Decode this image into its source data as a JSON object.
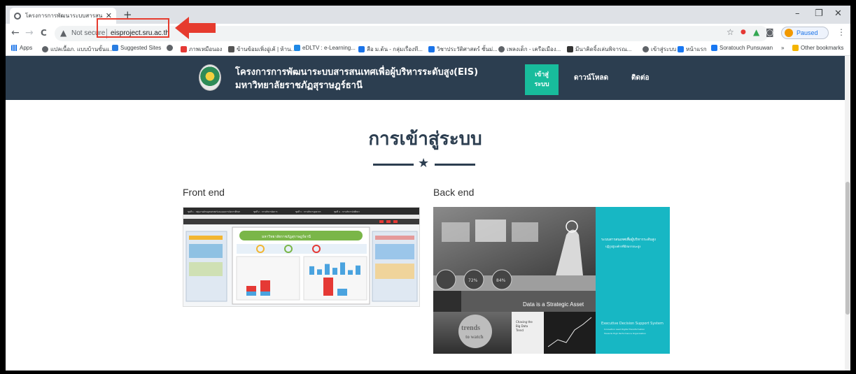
{
  "browser": {
    "tab_title": "โครงการการพัฒนาระบบสารสนเทศเพื่",
    "new_tab": "+",
    "window_controls": {
      "minimize": "–",
      "restore": "❐",
      "close": "✕"
    },
    "nav": {
      "back": "←",
      "forward": "→",
      "reload": "C"
    },
    "security_label": "Not secure",
    "url": "eisproject.sru.ac.th",
    "profile_status": "Paused",
    "bookmarks": [
      {
        "label": "Apps",
        "color": "#5f6368"
      },
      {
        "label": "แปลเนื้อภ. แบบบ้านขั้นแ...",
        "color": "#5f6368"
      },
      {
        "label": "Suggested Sites",
        "color": "#2a7de1"
      },
      {
        "label": "",
        "color": "#5f6368"
      },
      {
        "label": "ภาพเหมือนอง",
        "color": "#e53935"
      },
      {
        "label": "ข้านข้อมเพิ่งอู่เค้ | ห้าน...",
        "color": "#555555"
      },
      {
        "label": "eDLTV : e-Learning...",
        "color": "#1e88e5"
      },
      {
        "label": "สือ ม.ต้น - กลุ่มเรื่องที...",
        "color": "#1a73e8"
      },
      {
        "label": "วิชาประวัติศาสตร์ ชั้นม่...",
        "color": "#1a73e8"
      },
      {
        "label": "เพลงเด็ก - เครือเมือง...",
        "color": "#5f6368"
      },
      {
        "label": "มีนาคิดจิ้งเล่นพิจารณ...",
        "color": "#333333"
      },
      {
        "label": "เข้าสู่ระบบ",
        "color": "#5f6368"
      },
      {
        "label": "หน้าแรก",
        "color": "#1877f2"
      },
      {
        "label": "Soratouch Punsuwan",
        "color": "#1877f2"
      },
      {
        "label": "»",
        "color": "#5f6368"
      },
      {
        "label": "Other bookmarks",
        "color": "#f4b400"
      }
    ]
  },
  "site": {
    "title_line1": "โครงการการพัฒนาระบบสารสนเทศเพื่อผู้บริหารระดับสูง(EIS)",
    "title_line2": "มหาวิทยาลัยราชภัฏสุราษฎร์ธานี",
    "login_line1": "เข้าสู่",
    "login_line2": "ระบบ",
    "nav_download": "ดาวน์โหลด",
    "nav_contact": "ติดต่อ",
    "accent": "#18bc9c",
    "header_bg": "#2c3e50"
  },
  "content": {
    "heading": "การเข้าสู่ระบบ",
    "front_label": "Front end",
    "back_label": "Back end",
    "front_image": {
      "header_tabs": [
        "ชุดที่ 1 : กลุ่มงานด้านยุทธศาสตร์และแผนการจัดการศึกษา",
        "ชุดที่ 2 : การบริหารจัดการ",
        "ชุดที่ 3 : การบริหารบุคลากร",
        "ชุดที่ 4 : การบริหารนักศึกษา"
      ],
      "banner": "มหาวิทยาลัยราชภัฏสุราษฎร์ธานี",
      "bar_values": [
        0.55,
        0.35,
        0.7,
        0.45,
        0.8,
        0.3,
        0.6
      ]
    },
    "back_image": {
      "caption": "Data is a Strategic Asset",
      "trends": "trends to watch",
      "right_top": "ระบบสารสนเทศเพื่อผู้บริหารระดับสูง",
      "right_sub": "ปฏิรูปสู่องค์กรที่มีสมรรถนะสูง",
      "right_bottom": "Executive Decision Support System",
      "right_bottom_sub1": "Innovation Lead Digital Transformation",
      "right_bottom_sub2": "Towards High Performance Organization",
      "gauge1": "72%",
      "gauge2": "84%",
      "gauge3": "",
      "chart_card": "Chasing the Big Data Trend"
    }
  }
}
